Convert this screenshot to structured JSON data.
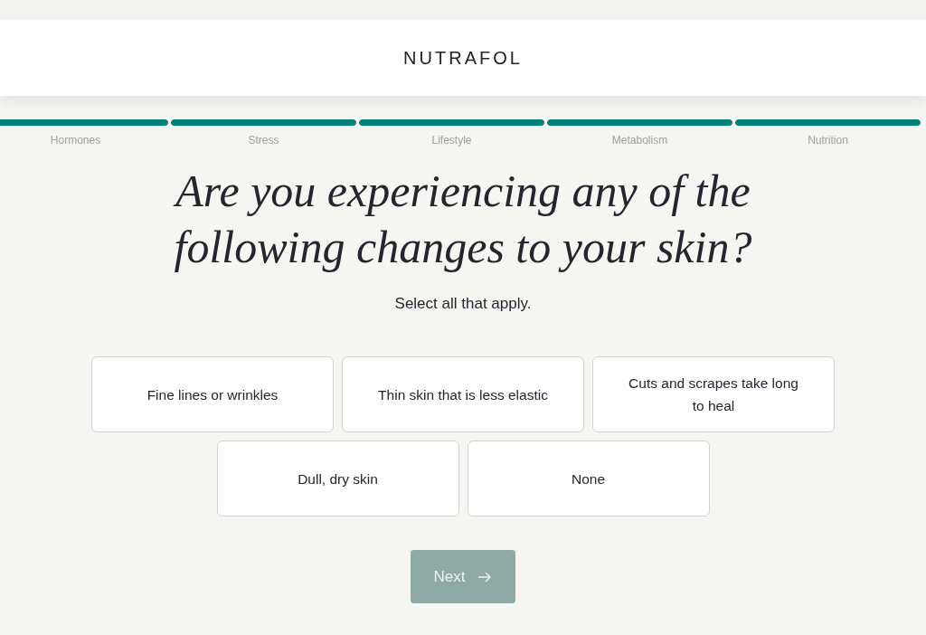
{
  "header": {
    "logo": "NUTRAFOL"
  },
  "progress": [
    {
      "label": "Hormones",
      "level": 1
    },
    {
      "label": "Stress",
      "level": 1
    },
    {
      "label": "Lifestyle",
      "level": 1
    },
    {
      "label": "Metabolism",
      "level": 1
    },
    {
      "label": "Nutrition",
      "level": 1
    }
  ],
  "question": {
    "title": "Are you experiencing any of the following changes to your skin?",
    "hint": "Select all that apply."
  },
  "options": [
    {
      "label": "Fine lines or wrinkles",
      "selected": false
    },
    {
      "label": "Thin skin that is less elastic",
      "selected": false
    },
    {
      "label": "Cuts and scrapes take long to heal",
      "selected": false
    },
    {
      "label": "Dull, dry skin",
      "selected": false
    },
    {
      "label": "None",
      "selected": false
    }
  ],
  "next_button": {
    "label": "Next",
    "disabled": true
  }
}
